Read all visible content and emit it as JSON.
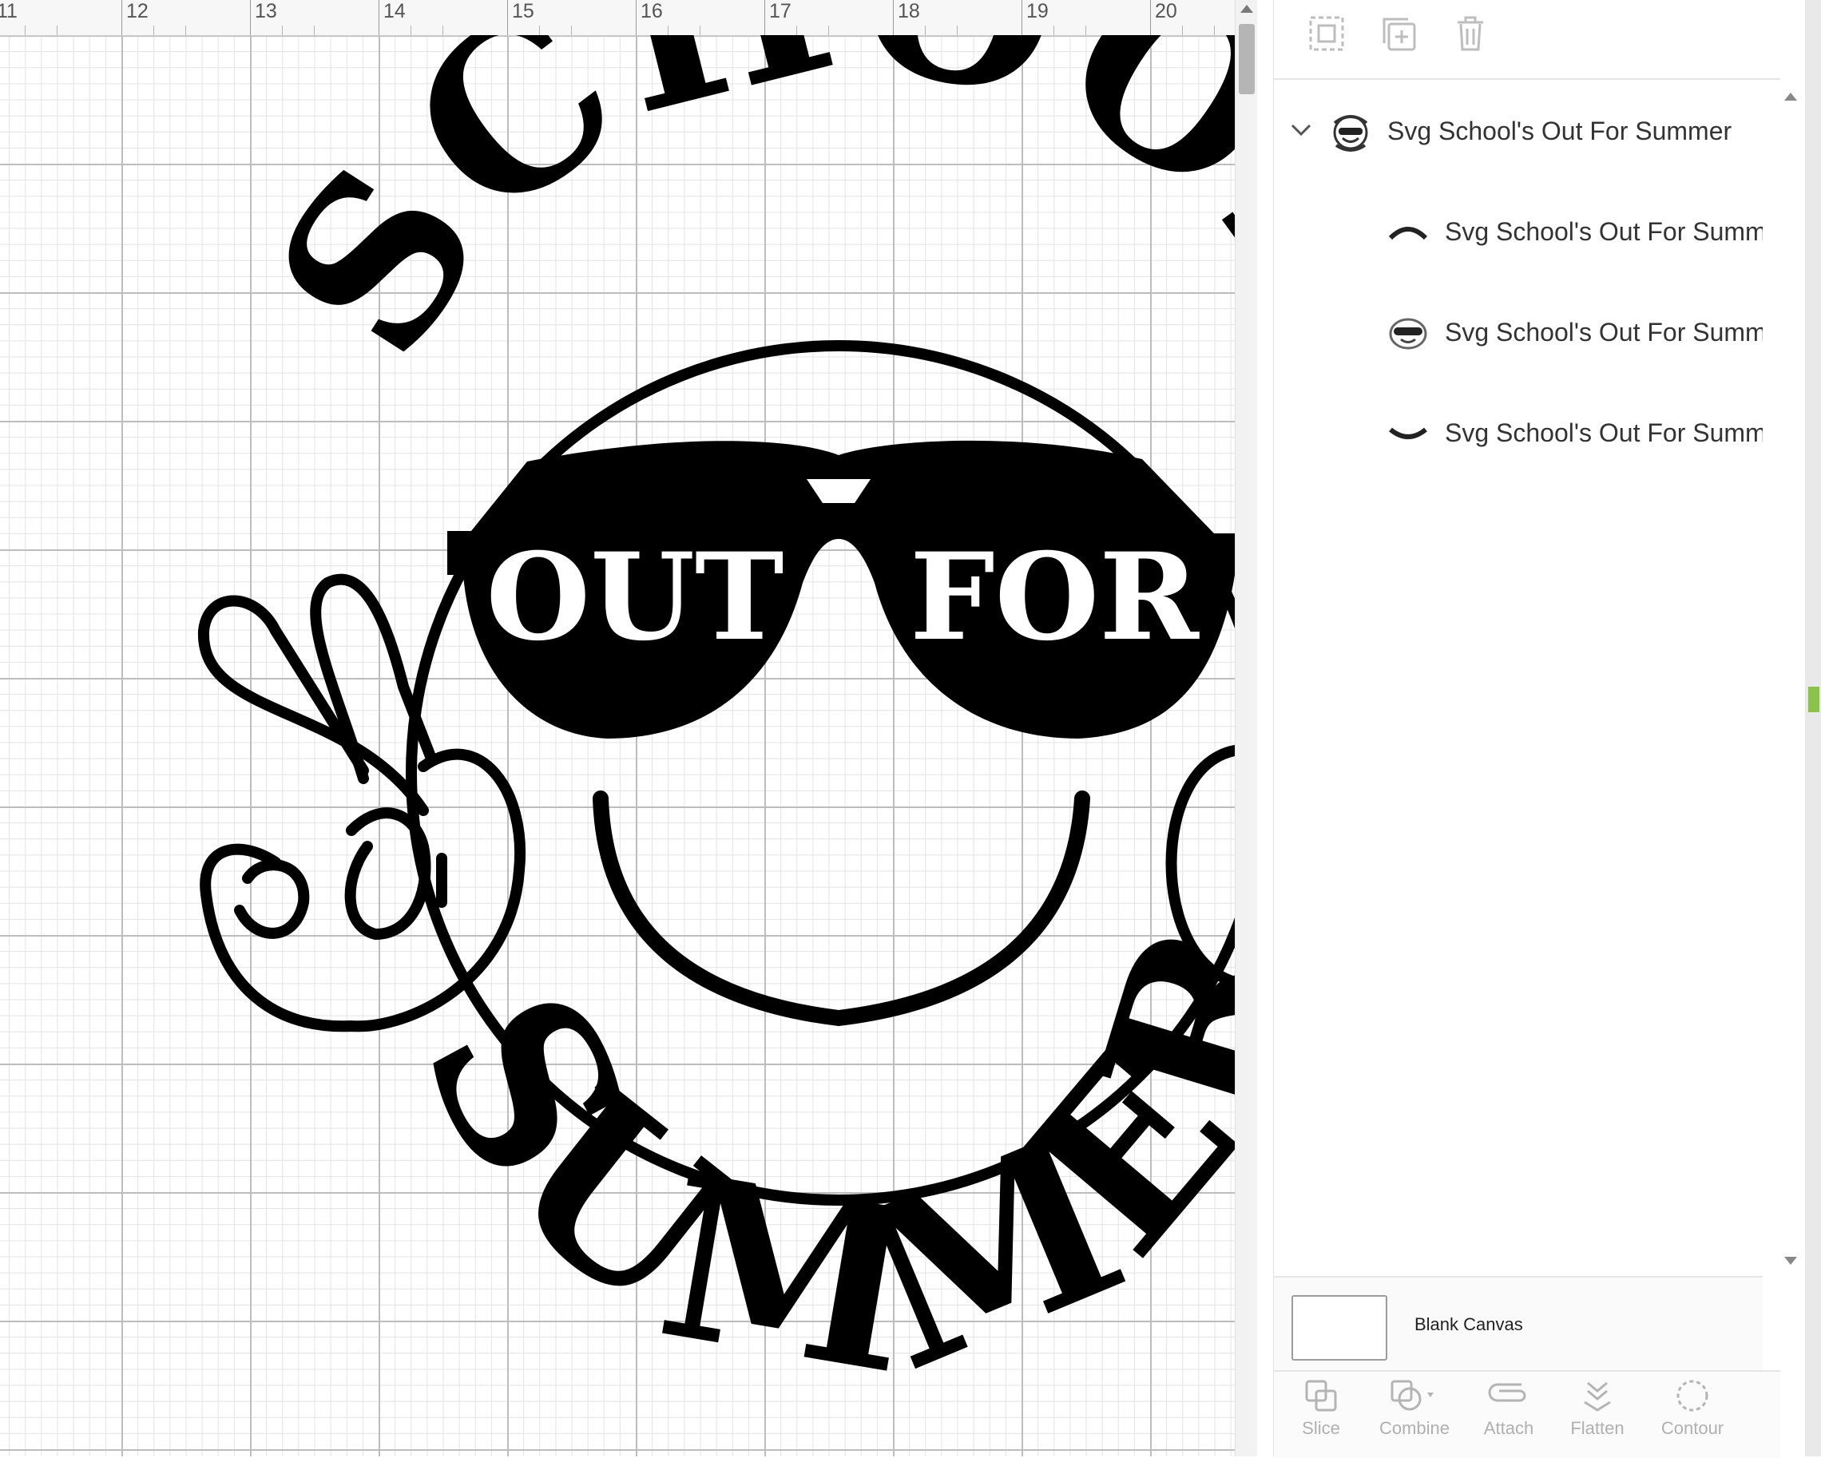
{
  "ruler": {
    "labels": [
      "11",
      "12",
      "13",
      "14",
      "15",
      "16",
      "17",
      "18",
      "19",
      "20"
    ]
  },
  "design": {
    "top_text": "SCHOOL'S",
    "glasses_left": "OUT",
    "glasses_right": "FOR",
    "bottom_text": "SUMMER"
  },
  "toolbar": {
    "icons": [
      "group-icon",
      "duplicate-icon",
      "delete-icon"
    ]
  },
  "layers": {
    "group": {
      "label": "Svg School's Out For Summer",
      "expanded": true
    },
    "children": [
      {
        "label": "Svg School's Out For Summer"
      },
      {
        "label": "Svg School's Out For Summer"
      },
      {
        "label": "Svg School's Out For Summer"
      }
    ]
  },
  "canvas": {
    "label": "Blank Canvas"
  },
  "bottom_tools": [
    {
      "label": "Slice",
      "icon": "slice-icon"
    },
    {
      "label": "Combine",
      "icon": "combine-icon"
    },
    {
      "label": "Attach",
      "icon": "attach-icon"
    },
    {
      "label": "Flatten",
      "icon": "flatten-icon"
    },
    {
      "label": "Contour",
      "icon": "contour-icon"
    }
  ],
  "colors": {
    "art": "#000000",
    "accent": "#8bc34a"
  }
}
